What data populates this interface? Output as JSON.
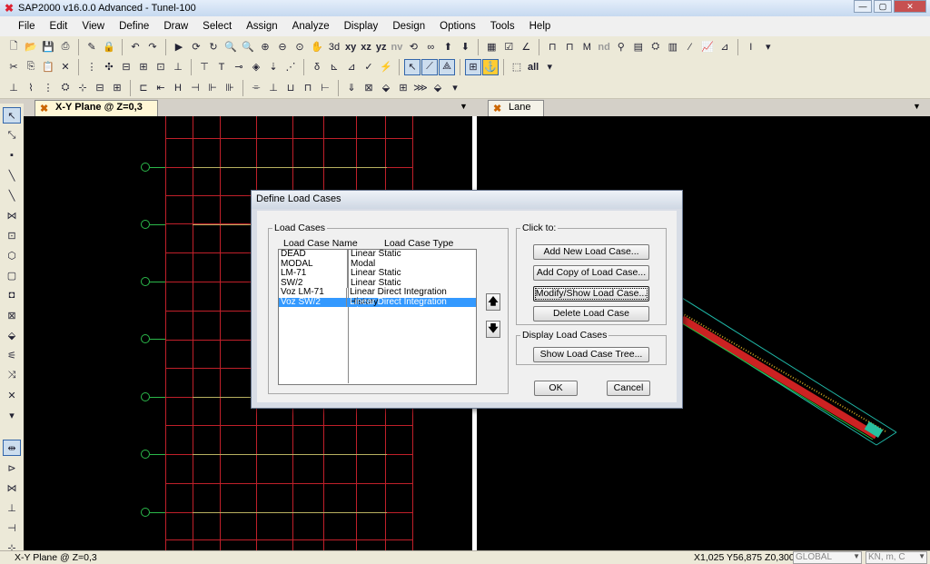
{
  "window": {
    "title": "SAP2000 v16.0.0 Advanced  - Tunel-100"
  },
  "menu": [
    "File",
    "Edit",
    "View",
    "Define",
    "Draw",
    "Select",
    "Assign",
    "Analyze",
    "Display",
    "Design",
    "Options",
    "Tools",
    "Help"
  ],
  "toolbar1_text": {
    "xy": "xy",
    "xz": "xz",
    "yz": "yz",
    "nv": "nv",
    "nd": "nd"
  },
  "toolbar2_text": {
    "all": "all"
  },
  "tabs": {
    "left": "X-Y Plane @ Z=0,3",
    "right": "Lane"
  },
  "dialog": {
    "title": "Define Load Cases",
    "group_load_cases": "Load Cases",
    "col_name": "Load Case Name",
    "col_type": "Load Case Type",
    "rows": [
      {
        "name": "DEAD",
        "type": "Linear Static"
      },
      {
        "name": "MODAL",
        "type": "Modal"
      },
      {
        "name": "LM-71",
        "type": "Linear Static"
      },
      {
        "name": "SW/2",
        "type": "Linear Static"
      },
      {
        "name": "Voz LM-71",
        "type": "Linear Direct Integration History"
      },
      {
        "name": "Voz SW/2",
        "type": "Linear Direct Integration History"
      }
    ],
    "selected_row": "Voz SW/2",
    "group_click_to": "Click to:",
    "btn_add_new": "Add New Load Case...",
    "btn_add_copy": "Add Copy of Load Case...",
    "btn_modify": "Modify/Show Load Case...",
    "btn_delete": "Delete Load Case",
    "group_display": "Display Load Cases",
    "btn_show_tree": "Show Load Case Tree...",
    "btn_ok": "OK",
    "btn_cancel": "Cancel",
    "arrow_up": "🡅",
    "arrow_down": "🡇"
  },
  "status": {
    "left": "X-Y Plane @ Z=0,3",
    "coords": "X1,025  Y56,875  Z0,300",
    "coord_system": "GLOBAL",
    "units": "KN, m, C"
  },
  "colors": {
    "grid": "#c0202a",
    "bubble": "#2bb84a",
    "selection": "#3399ff",
    "lane": "#c22"
  }
}
